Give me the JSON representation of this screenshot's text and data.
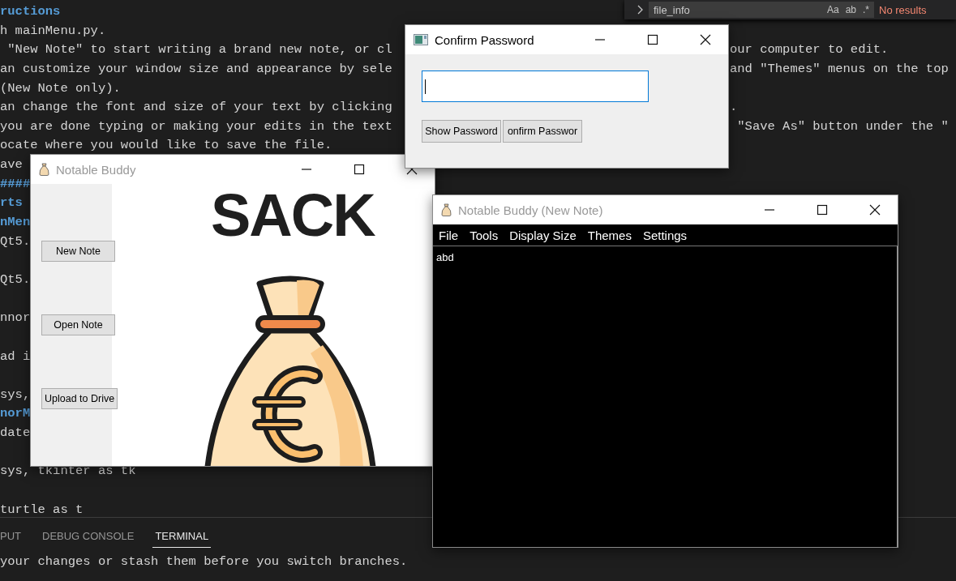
{
  "find_widget": {
    "query": "file_info",
    "options": [
      "Aa",
      "ab",
      ".*"
    ],
    "status": "No results"
  },
  "editor": {
    "lines": [
      {
        "kind": "heading",
        "text": "ructions"
      },
      {
        "kind": "text",
        "text": "h mainMenu.py."
      },
      {
        "kind": "text",
        "text": " \"New Note\" to start writing a brand new note, or cl",
        "right_text": "our computer to edit."
      },
      {
        "kind": "text",
        "text": "an customize your window size and appearance by sele",
        "right_text": "and \"Themes\" menus on the top"
      },
      {
        "kind": "text",
        "text": "(New Note only)."
      },
      {
        "kind": "text",
        "text": "an change the font and size of your text by clicking",
        "right_text": "."
      },
      {
        "kind": "text",
        "text": "you are done typing or making your edits in the text",
        "right_text": " \"Save As\" button under the \""
      },
      {
        "kind": "text",
        "text": "ocate where you would like to save the file."
      },
      {
        "kind": "text",
        "text": "ave"
      },
      {
        "kind": "heading",
        "text": "####"
      },
      {
        "kind": "heading",
        "text": "rts"
      },
      {
        "kind": "heading",
        "text": "nMen"
      },
      {
        "kind": "text",
        "text": "Qt5."
      },
      {
        "kind": "blank"
      },
      {
        "kind": "text",
        "text": "Qt5."
      },
      {
        "kind": "blank"
      },
      {
        "kind": "text",
        "text": "nnor"
      },
      {
        "kind": "blank"
      },
      {
        "kind": "text",
        "text": "ad i"
      },
      {
        "kind": "blank"
      },
      {
        "kind": "text",
        "text": "sys,"
      },
      {
        "kind": "heading",
        "text": "norM"
      },
      {
        "kind": "text",
        "text": "date"
      },
      {
        "kind": "blank"
      },
      {
        "kind": "text",
        "text": "sys, tkinter as tk"
      },
      {
        "kind": "blank"
      },
      {
        "kind": "text",
        "text": "turtle as t"
      }
    ]
  },
  "panel": {
    "tabs": [
      {
        "label": "PUT",
        "selected": false
      },
      {
        "label": "DEBUG CONSOLE",
        "selected": false
      },
      {
        "label": "TERMINAL",
        "selected": true
      }
    ],
    "terminal_text": "your changes or stash them before you switch branches."
  },
  "windows": [
    {
      "kind": "confirm_password",
      "title": "Confirm Password",
      "active": true,
      "password_field": {
        "focused": true
      },
      "buttons": [
        "Show Password",
        "onfirm Passwor"
      ]
    },
    {
      "kind": "main_menu",
      "title": "Notable Buddy",
      "active": false,
      "buttons": [
        "New Note",
        "Open Note",
        "Upload to Drive"
      ],
      "logo_text": "SACK"
    },
    {
      "kind": "note_editor",
      "title": "Notable Buddy (New Note)",
      "active": false,
      "menu": [
        "File",
        "Tools",
        "Display Size",
        "Themes",
        "Settings"
      ],
      "text": "abd"
    }
  ]
}
